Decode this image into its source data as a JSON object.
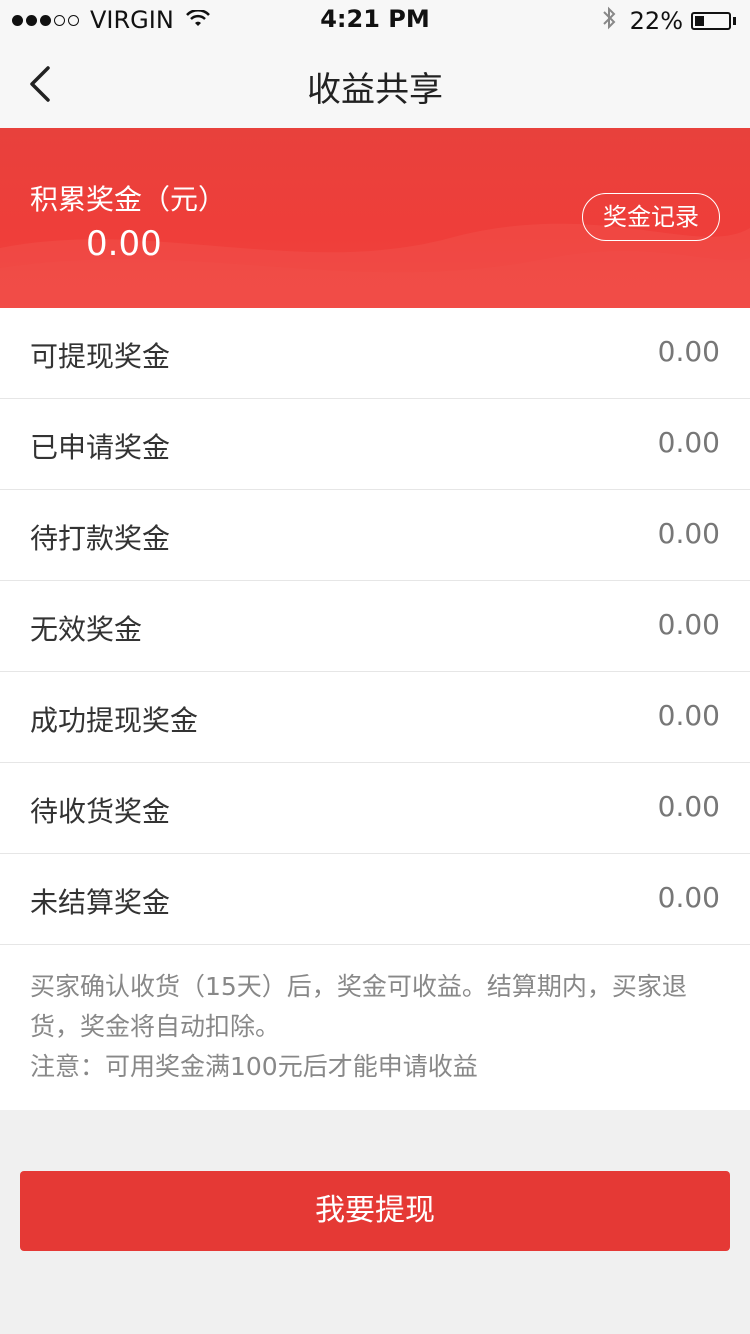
{
  "statusbar": {
    "carrier": "VIRGIN",
    "time": "4:21 PM",
    "battery": "22%",
    "battery_level": 0.22
  },
  "navbar": {
    "title": "收益共享",
    "back_icon": "chevron-left-icon"
  },
  "hero": {
    "label": "积累奖金（元）",
    "amount": "0.00",
    "record_button": "奖金记录"
  },
  "items": [
    {
      "label": "可提现奖金",
      "value": "0.00"
    },
    {
      "label": "已申请奖金",
      "value": "0.00"
    },
    {
      "label": "待打款奖金",
      "value": "0.00"
    },
    {
      "label": "无效奖金",
      "value": "0.00"
    },
    {
      "label": "成功提现奖金",
      "value": "0.00"
    },
    {
      "label": "待收货奖金",
      "value": "0.00"
    },
    {
      "label": "未结算奖金",
      "value": "0.00"
    }
  ],
  "note": {
    "line1": "买家确认收货（15天）后，奖金可收益。结算期内，买家退货，奖金将自动扣除。",
    "line2": "注意：可用奖金满100元后才能申请收益"
  },
  "withdraw_button": "我要提现",
  "colors": {
    "accent": "#e53935",
    "hero_bg": "#ef3e3a"
  }
}
